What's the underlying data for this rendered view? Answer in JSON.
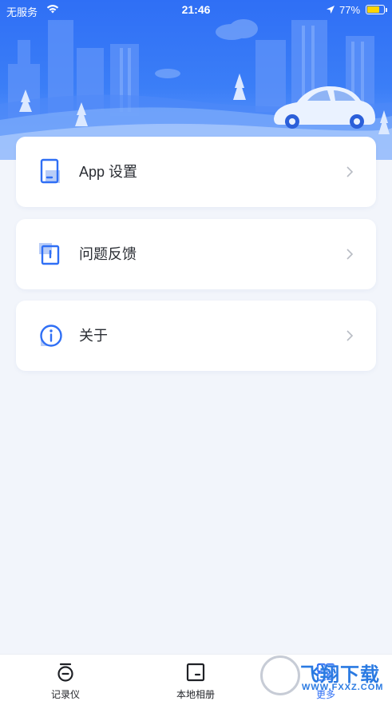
{
  "status_bar": {
    "carrier": "无服务",
    "time": "21:46",
    "battery_percent": "77%",
    "battery_level": 0.77,
    "battery_color": "#ffd400"
  },
  "menu": [
    {
      "label": "App 设置",
      "icon": "tablet-settings-icon"
    },
    {
      "label": "问题反馈",
      "icon": "feedback-book-icon"
    },
    {
      "label": "关于",
      "icon": "info-circle-icon"
    }
  ],
  "tabs": [
    {
      "label": "记录仪",
      "icon": "dashcam-icon",
      "active": false
    },
    {
      "label": "本地相册",
      "icon": "album-icon",
      "active": false
    },
    {
      "label": "更多",
      "icon": "more-icon",
      "active": true
    }
  ],
  "watermark": {
    "text": "飞翔下载",
    "url": "WWW.FXXZ.COM"
  },
  "colors": {
    "accent": "#2f6ff5",
    "background": "#f2f5fb",
    "card": "#ffffff",
    "text": "#2a2d33"
  }
}
